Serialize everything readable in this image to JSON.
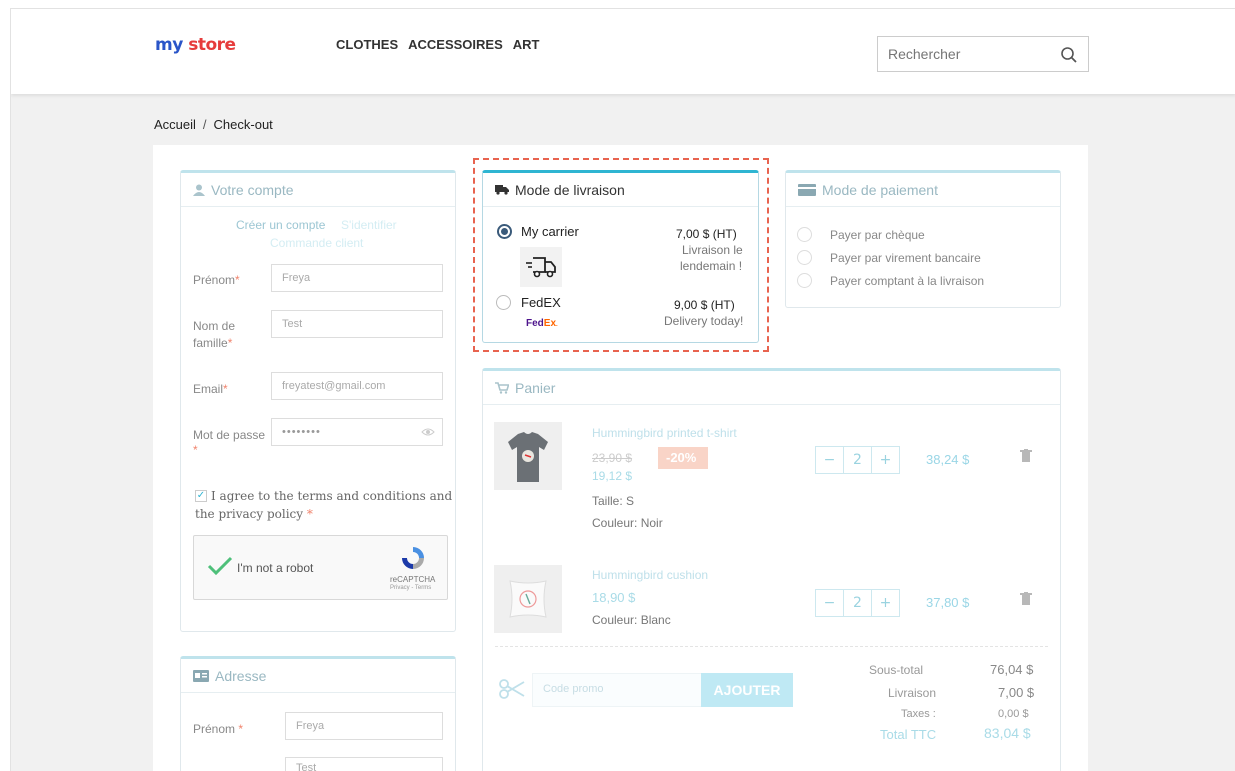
{
  "header": {
    "logo_my": "my",
    "logo_store": "store",
    "nav": [
      "CLOTHES",
      "ACCESSOIRES",
      "ART"
    ],
    "search_placeholder": "Rechercher"
  },
  "breadcrumb": {
    "home": "Accueil",
    "separator": "/",
    "current": "Check-out"
  },
  "account": {
    "title": "Votre compte",
    "tab_create": "Créer un compte",
    "tab_login": "S'identifier",
    "tab_guest": "Commande client",
    "firstname_label": "Prénom",
    "firstname_value": "Freya",
    "lastname_label_1": "Nom de",
    "lastname_label_2": "famille",
    "lastname_value": "Test",
    "email_label": "Email",
    "email_value": "freyatest@gmail.com",
    "password_label_1": "Mot de passe",
    "password_label_2": "*",
    "password_value": "••••••••",
    "terms_1": "I agree to the terms and conditions and",
    "terms_2": "the privacy policy",
    "captcha_label": "I'm not a robot",
    "captcha_brand": "reCAPTCHA",
    "captcha_links": "Privacy - Terms"
  },
  "address": {
    "title": "Adresse",
    "firstname_label": "Prénom",
    "firstname_value": "Freya",
    "lastname_value": "Test"
  },
  "shipping": {
    "title": "Mode de livraison",
    "options": [
      {
        "name": "My carrier",
        "price": "7,00 $ (HT)",
        "delay_1": "Livraison le",
        "delay_2": "lendemain !",
        "selected": true
      },
      {
        "name": "FedEX",
        "price": "9,00 $ (HT)",
        "delay_1": "Delivery today!",
        "logo": "FedEx",
        "selected": false
      }
    ]
  },
  "payment": {
    "title": "Mode de paiement",
    "options": [
      "Payer par chèque",
      "Payer par virement bancaire",
      "Payer comptant à la livraison"
    ]
  },
  "cart": {
    "title": "Panier",
    "items": [
      {
        "name": "Hummingbird printed t-shirt",
        "old_price": "23,90 $",
        "discount": "-20%",
        "price": "19,12 $",
        "attr_1": "Taille: S",
        "attr_2": "Couleur: Noir",
        "qty": "2",
        "total": "38,24 $"
      },
      {
        "name": "Hummingbird cushion",
        "price": "18,90 $",
        "attr_1": "Couleur: Blanc",
        "qty": "2",
        "total": "37,80 $"
      }
    ],
    "promo_placeholder": "Code promo",
    "add_button": "AJOUTER",
    "summary": [
      {
        "label": "Sous-total",
        "value": "76,04 $"
      },
      {
        "label": "Livraison",
        "value": "7,00 $"
      },
      {
        "label": "Taxes :",
        "value": "0,00 $"
      },
      {
        "label": "Total TTC",
        "value": "83,04 $"
      }
    ]
  },
  "colors": {
    "accent": "#2fb5d2",
    "highlight": "#e8634f",
    "discount_bg": "#f8cfc2"
  }
}
